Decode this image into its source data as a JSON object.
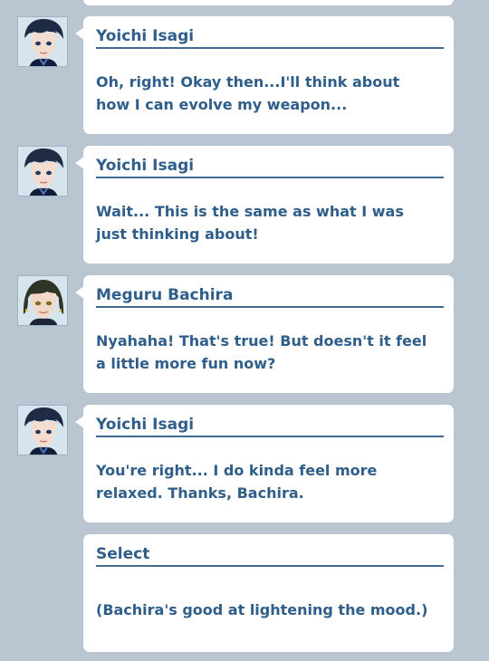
{
  "log": {
    "entries": [
      {
        "speaker": "Yoichi Isagi",
        "text": "Oh, right! Okay then...I'll think about\nhow I can evolve my weapon...",
        "avatar_icon": "isagi-portrait-icon"
      },
      {
        "speaker": "Yoichi Isagi",
        "text": "Wait... This is the same as what I was\njust thinking about!",
        "avatar_icon": "isagi-portrait-icon"
      },
      {
        "speaker": "Meguru Bachira",
        "text": "Nyahaha! That's true! But doesn't it feel\na little more fun now?",
        "avatar_icon": "bachira-portrait-icon"
      },
      {
        "speaker": "Yoichi Isagi",
        "text": "You're right... I do kinda feel more\nrelaxed. Thanks, Bachira.",
        "avatar_icon": "isagi-portrait-icon"
      },
      {
        "speaker": "Select",
        "text": "(Bachira's good at lightening the mood.)"
      }
    ]
  },
  "colors": {
    "background": "#b9c5d0",
    "bubble": "#ffffff",
    "text": "#2f5e8a",
    "divider": "#3f6b92"
  }
}
